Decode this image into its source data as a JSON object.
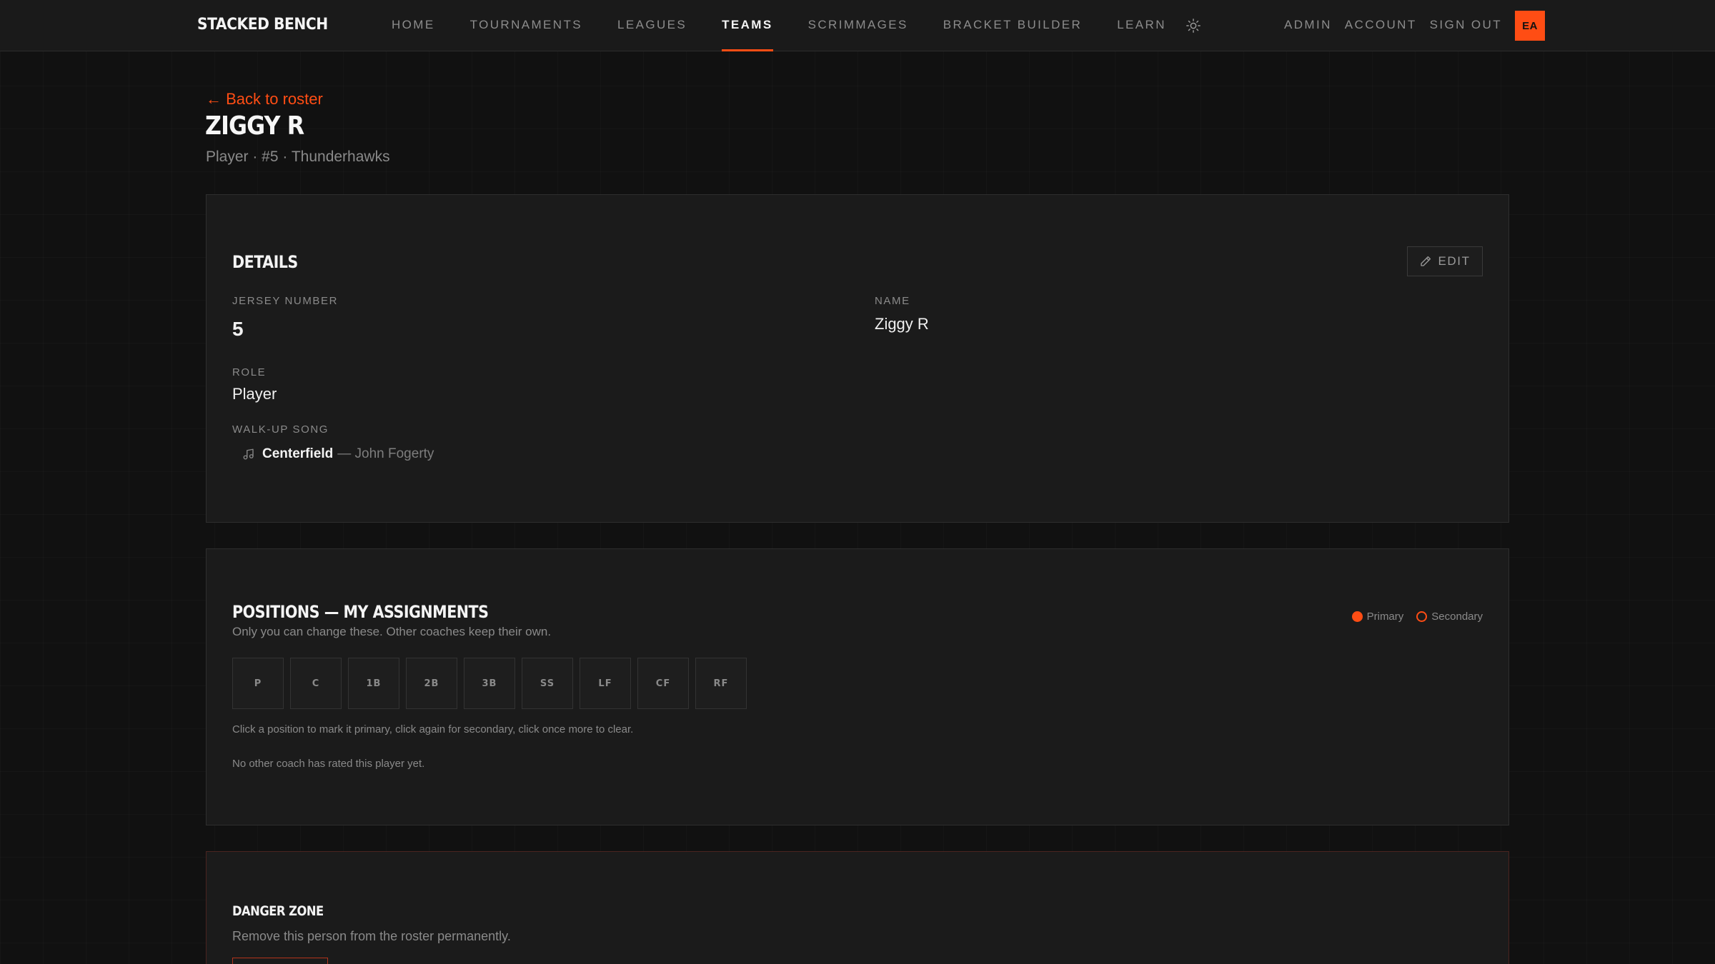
{
  "brand": "STACKED BENCH",
  "nav": {
    "links": [
      {
        "label": "HOME",
        "active": false
      },
      {
        "label": "TOURNAMENTS",
        "active": false
      },
      {
        "label": "LEAGUES",
        "active": false
      },
      {
        "label": "TEAMS",
        "active": true
      },
      {
        "label": "SCRIMMAGES",
        "active": false
      },
      {
        "label": "BRACKET BUILDER",
        "active": false
      },
      {
        "label": "LEARN",
        "active": false
      }
    ],
    "right": [
      "ADMIN",
      "ACCOUNT",
      "SIGN OUT"
    ],
    "avatar_initials": "EA",
    "theme_icon": "sun-icon"
  },
  "header": {
    "back_label": "← Back to roster",
    "title": "ZIGGY R",
    "subtitle": "Player · #5 · Thunderhawks"
  },
  "details": {
    "title": "DETAILS",
    "edit_label": "EDIT",
    "jersey_label": "JERSEY NUMBER",
    "jersey_value": "5",
    "name_label": "NAME",
    "name_value": "Ziggy R",
    "role_label": "ROLE",
    "role_value": "Player",
    "song_label": "WALK-UP SONG",
    "song_title": "Centerfield",
    "song_artist": "— John Fogerty"
  },
  "positions": {
    "title": "POSITIONS — MY ASSIGNMENTS",
    "subtitle": "Only you can change these. Other coaches keep their own.",
    "legend_primary": "Primary",
    "legend_secondary": "Secondary",
    "items": [
      "P",
      "C",
      "1B",
      "2B",
      "3B",
      "SS",
      "LF",
      "CF",
      "RF"
    ],
    "hint": "Click a position to mark it primary, click again for secondary, click once more to clear.",
    "note": "No other coach has rated this player yet."
  },
  "danger": {
    "title": "DANGER ZONE",
    "description": "Remove this person from the roster permanently."
  },
  "colors": {
    "accent": "#ff4d14",
    "background": "#111111",
    "card": "#1b1b1b"
  }
}
